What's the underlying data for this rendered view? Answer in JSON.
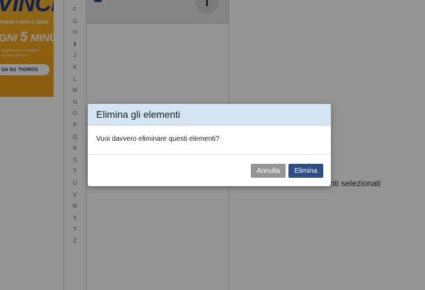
{
  "ad": {
    "headline": "VINCI",
    "subline": "PREMI FANTA E XBOX",
    "big_prefix": "GNI",
    "big_number": "5",
    "big_suffix": "MINUTI",
    "fine_print_1": "regolamento completo",
    "fine_print_2": "su www.fanta.it",
    "button_prefix": "SA SU",
    "button_brand": "TIGROS"
  },
  "alphabet": {
    "letters": [
      "F",
      "G",
      "H",
      "I",
      "J",
      "K",
      "L",
      "M",
      "N",
      "O",
      "P",
      "Q",
      "R",
      "S",
      "T",
      "U",
      "V",
      "W",
      "X",
      "Y",
      "Z"
    ],
    "active": "I"
  },
  "middle": {
    "avatar_initial": "I"
  },
  "right_panel": {
    "selection_text": "enti selezionati"
  },
  "modal": {
    "title": "Elimina gli elementi",
    "message": "Vuoi davvero eliminare questi elementi?",
    "cancel_label": "Annulla",
    "confirm_label": "Elimina"
  },
  "colors": {
    "header_bg": "#d4e4f2",
    "confirm_bg": "#2d4e86",
    "cancel_bg": "#959595",
    "overlay": "rgba(0,0,0,0.42)"
  }
}
